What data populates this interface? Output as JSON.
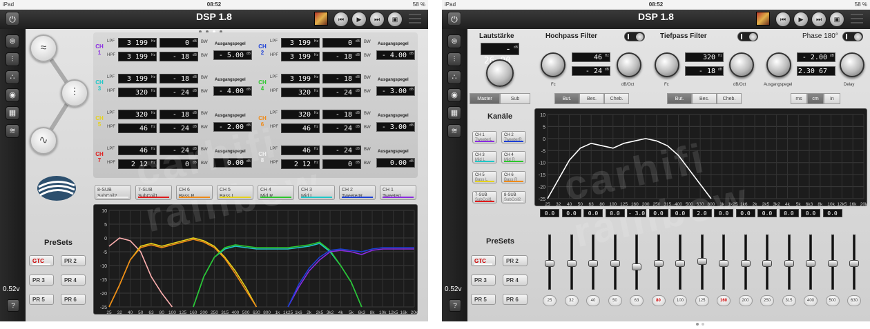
{
  "status": {
    "carrier": "iPad",
    "time": "08:52",
    "battery": "58 %"
  },
  "app_title": "DSP 1.8",
  "voltage": "0.52v",
  "help_label": "?",
  "left": {
    "channels": [
      {
        "name": "CH 1",
        "color": "#8a2be2",
        "lpf": "3 199",
        "lpf_db": "0",
        "hpf": "3 199",
        "hpf_db": "- 18",
        "gain": "- 5.00"
      },
      {
        "name": "CH 2",
        "color": "#1c3fd6",
        "lpf": "3 199",
        "lpf_db": "0",
        "hpf": "3 199",
        "hpf_db": "- 18",
        "gain": "- 4.00"
      },
      {
        "name": "CH 3",
        "color": "#1ec8c8",
        "lpf": "3 199",
        "lpf_db": "- 18",
        "hpf": "320",
        "hpf_db": "- 24",
        "gain": "- 4.00"
      },
      {
        "name": "CH 4",
        "color": "#2cc72c",
        "lpf": "3 199",
        "lpf_db": "- 18",
        "hpf": "320",
        "hpf_db": "- 24",
        "gain": "- 3.00"
      },
      {
        "name": "CH 5",
        "color": "#e6d21c",
        "lpf": "320",
        "lpf_db": "- 18",
        "hpf": "46",
        "hpf_db": "- 24",
        "gain": "- 2.00"
      },
      {
        "name": "CH 6",
        "color": "#ef8a17",
        "lpf": "320",
        "lpf_db": "- 18",
        "hpf": "46",
        "hpf_db": "- 24",
        "gain": "- 3.00"
      },
      {
        "name": "CH 7",
        "color": "#e01b1b",
        "lpf": "46",
        "lpf_db": "- 24",
        "hpf": "2 12",
        "hpf_db": "0",
        "gain": "0.00"
      },
      {
        "name": "CH 8",
        "color": "#f0f0f0",
        "lpf": "46",
        "lpf_db": "- 24",
        "hpf": "2 12",
        "hpf_db": "0",
        "gain": "0.00"
      }
    ],
    "labels": {
      "lpf": "LPF",
      "hpf": "HPF",
      "bw": "BW",
      "gain": "Ausgangspegel",
      "hz": "Hz",
      "db": "dB"
    },
    "chips": [
      {
        "title": "8-SUB",
        "sub": "SubCoil2",
        "color": "#eeeeee"
      },
      {
        "title": "7-SUB",
        "sub": "SubCoil1",
        "color": "#e01b1b"
      },
      {
        "title": "CH 6",
        "sub": "Bass R",
        "color": "#ef8a17"
      },
      {
        "title": "CH 5",
        "sub": "Bass L",
        "color": "#e6d21c"
      },
      {
        "title": "CH 4",
        "sub": "Mid R",
        "color": "#2cc72c"
      },
      {
        "title": "CH 3",
        "sub": "Mid L",
        "color": "#1ec8c8"
      },
      {
        "title": "CH 2",
        "sub": "TweeterR",
        "color": "#1c3fd6"
      },
      {
        "title": "CH 1",
        "sub": "TweeterL",
        "color": "#8a2be2"
      }
    ]
  },
  "presets": {
    "title": "PreSets",
    "items": [
      "GTC",
      "PR 2",
      "PR 3",
      "PR 4",
      "PR 5",
      "PR 6"
    ],
    "active": "GTC"
  },
  "graph": {
    "y_ticks": [
      "10",
      "5",
      "0",
      "-5",
      "-10",
      "-15",
      "-20",
      "-25"
    ],
    "x_ticks": [
      "25",
      "32",
      "40",
      "50",
      "63",
      "80",
      "100",
      "125",
      "160",
      "200",
      "250",
      "315",
      "400",
      "500",
      "630",
      "800",
      "1k",
      "1k25",
      "1k6",
      "2k",
      "2k5",
      "3k2",
      "4k",
      "5k",
      "6k3",
      "8k",
      "10k",
      "12k5",
      "16k",
      "20k"
    ]
  },
  "right": {
    "volume_title": "Lautstärke",
    "volume_value": "- 26.00",
    "master_label": "Master",
    "sub_label": "Sub",
    "hp_title": "Hochpass Filter",
    "lp_title": "Tiefpass Filter",
    "phase_label": "Phase 180°",
    "hp_freq": "46",
    "hp_db": "- 24",
    "lp_freq": "320",
    "lp_db": "- 18",
    "gain_value": "- 2.00",
    "delay_value": "2.30 67",
    "fc_label": "Fc",
    "dboct_label": "dB/Oct",
    "gain_label": "Ausgangspegel",
    "delay_label": "Delay",
    "filter_types": [
      "But.",
      "Bes.",
      "Cheb."
    ],
    "units": [
      "ms",
      "cm",
      "in"
    ],
    "unit_active": "cm",
    "kanale_title": "Kanäle",
    "channels": [
      {
        "title": "CH 1",
        "sub": "TweeterL",
        "color": "#8a2be2"
      },
      {
        "title": "CH 2",
        "sub": "TweeterR",
        "color": "#1c3fd6"
      },
      {
        "title": "CH 3",
        "sub": "Mid L",
        "color": "#1ec8c8"
      },
      {
        "title": "CH 4",
        "sub": "Mid R",
        "color": "#2cc72c"
      },
      {
        "title": "CH 5",
        "sub": "Bass L",
        "color": "#e6d21c"
      },
      {
        "title": "CH 6",
        "sub": "Bass R",
        "color": "#ef8a17"
      },
      {
        "title": "7-SUB",
        "sub": "SubCoil1",
        "color": "#e01b1b"
      },
      {
        "title": "8-SUB",
        "sub": "SubCoil2",
        "color": "#eeeeee"
      }
    ],
    "eq_gains": [
      "0.0",
      "0.0",
      "0.0",
      "0.0",
      "- 3.0",
      "0.0",
      "0.0",
      "2.0",
      "0.0",
      "0.0",
      "0.0",
      "0.0",
      "0.0",
      "0.0"
    ],
    "eq_freqs": [
      "25",
      "32",
      "40",
      "50",
      "63",
      "80",
      "100",
      "125",
      "160",
      "200",
      "250",
      "315",
      "400",
      "500",
      "630"
    ],
    "eq_highlight": [
      "80",
      "160"
    ]
  },
  "watermark": "carhifi rainbow"
}
